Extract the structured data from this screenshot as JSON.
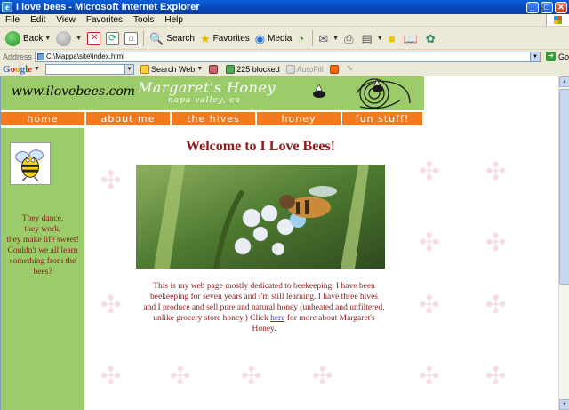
{
  "window": {
    "title": "I love bees - Microsoft Internet Explorer",
    "minimize": "_",
    "maximize": "□",
    "close": "✕"
  },
  "menu": [
    "File",
    "Edit",
    "View",
    "Favorites",
    "Tools",
    "Help"
  ],
  "toolbar": {
    "back_label": "Back",
    "search_label": "Search",
    "favorites_label": "Favorites",
    "media_label": "Media"
  },
  "address": {
    "label": "Address",
    "url": "C:\\Mappa\\site\\index.html",
    "go_label": "Go"
  },
  "googlebar": {
    "logo": [
      "G",
      "o",
      "o",
      "g",
      "l",
      "e"
    ],
    "search_web": "Search Web",
    "blocked": "225 blocked",
    "autofill": "AutoFill"
  },
  "page": {
    "site_url": "www.ilovebees.com",
    "brand_title": "Margaret's Honey",
    "brand_subtitle": "napa valley, ca",
    "nav": [
      "home",
      "about me",
      "the hives",
      "honey",
      "fun stuff!"
    ],
    "poem": [
      "They dance,",
      "they work,",
      "they make life sweet!",
      "Couldn't we all learn",
      "something from the",
      "bees?"
    ],
    "welcome": "Welcome to I Love Bees!",
    "intro_before": "This is my web page mostly dedicated to beekeeping. I have been beekeeping for seven years and I'm still learning. I have three hives and I produce and sell pure and natural honey (unheated and unfiltered, unlike grocery store honey.) Click ",
    "intro_link": "here",
    "intro_after": " for more about Margaret's Honey."
  },
  "colors": {
    "banner_green": "#9ccc6a",
    "nav_orange": "#f47a20",
    "text_maroon": "#8a1a1a",
    "link_blue": "#3333cc",
    "xp_title_blue": "#0846b8"
  }
}
